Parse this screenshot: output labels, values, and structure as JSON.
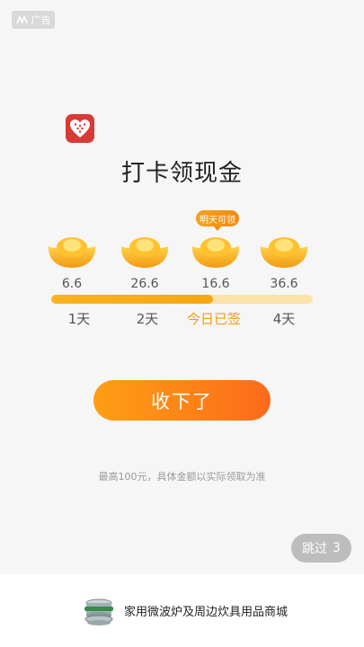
{
  "ad": {
    "label": "广告"
  },
  "title": "打卡领现金",
  "tooltip": "明天可领",
  "days": [
    {
      "amount": "6.6",
      "label": "1天"
    },
    {
      "amount": "26.6",
      "label": "2天"
    },
    {
      "amount": "16.6",
      "label": "今日已签"
    },
    {
      "amount": "36.6",
      "label": "4天"
    }
  ],
  "progress": {
    "fraction": 0.62
  },
  "cta_label": "收下了",
  "note": "最高100元，具体金额以实际领取为准",
  "skip": {
    "label": "跳过",
    "countdown": "3"
  },
  "bottom": {
    "text": "家用微波炉及周边炊具用品商城"
  },
  "colors": {
    "accent": "#f39a12",
    "brand_red": "#d93a36"
  },
  "icons": {
    "logo": "heart-logo-icon",
    "ingot": "gold-ingot-icon",
    "ad": "ad-mark-icon",
    "product": "cookware-icon"
  }
}
